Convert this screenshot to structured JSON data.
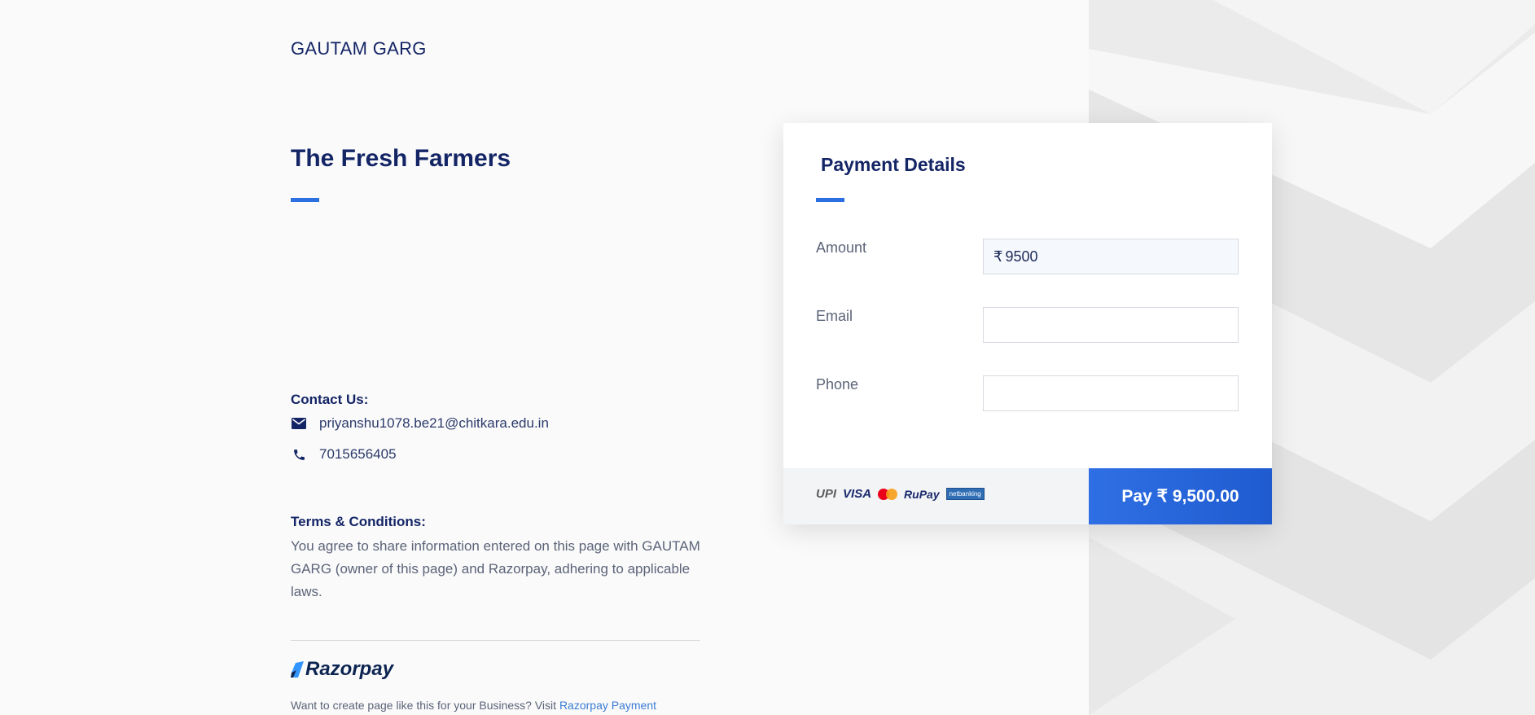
{
  "merchant": {
    "name": "GAUTAM GARG"
  },
  "page": {
    "title": "The Fresh Farmers"
  },
  "contact": {
    "heading": "Contact Us:",
    "email": "priyanshu1078.be21@chitkara.edu.in",
    "phone": "7015656405",
    "email_icon": "mail-icon",
    "phone_icon": "phone-icon"
  },
  "terms": {
    "heading": "Terms & Conditions:",
    "text": "You agree to share information entered on this page with GAUTAM GARG (owner of this page) and Razorpay, adhering to applicable laws."
  },
  "footer": {
    "brand": "Razorpay",
    "text": "Want to create page like this for your Business? Visit",
    "link": "Razorpay Payment"
  },
  "payment_form": {
    "title": "Payment Details",
    "amount_label": "Amount",
    "currency_symbol": "₹",
    "amount_value": "9500",
    "email_label": "Email",
    "email_value": "",
    "phone_label": "Phone",
    "phone_value": "",
    "pay_button": "Pay  ₹ 9,500.00",
    "methods": {
      "upi": "UPI",
      "visa": "VISA",
      "rupay": "RuPay",
      "bank": "netbanking"
    }
  },
  "colors": {
    "accent": "#2b6fe0",
    "heading": "#142566",
    "pay_button": "#2f6fe4"
  }
}
